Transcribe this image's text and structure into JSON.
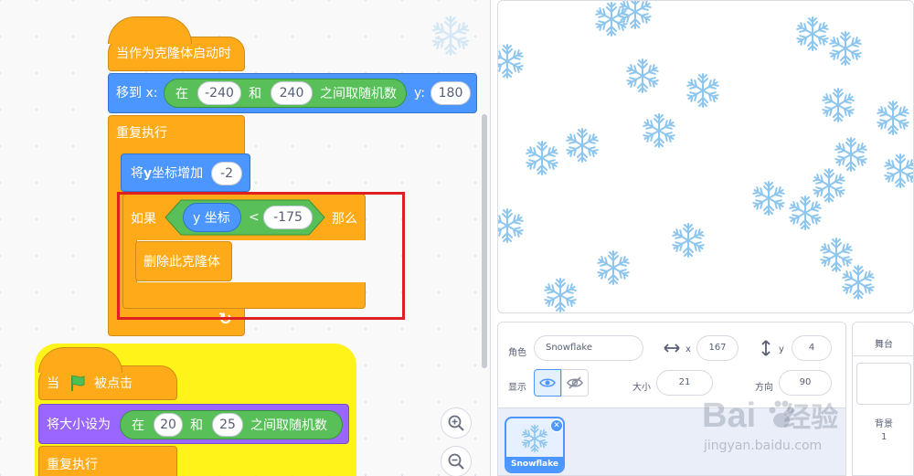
{
  "code": {
    "clone_block": {
      "hat_label": "当作为克隆体启动时",
      "goto_label": "移到 x:",
      "random_in": "在",
      "random_from": "-240",
      "random_and": "和",
      "random_to": "240",
      "random_label": "之间取随机数",
      "y_label": "y:",
      "y_value": "180",
      "forever_label": "重复执行",
      "change_y_label_pre": "将",
      "change_y_label_y": "y",
      "change_y_label_post": "坐标增加",
      "change_y_value": "-2",
      "if_label": "如果",
      "y_reporter": "y 坐标",
      "lt_sign": "<",
      "lt_value": "-175",
      "then_label": "那么",
      "delete_clone_label": "删除此克隆体"
    },
    "flag_block": {
      "hat_when": "当",
      "hat_clicked": "被点击",
      "set_size_label": "将大小设为",
      "random_in": "在",
      "random_from": "20",
      "random_and": "和",
      "random_to": "25",
      "random_label": "之间取随机数",
      "forever_label": "重复执行"
    },
    "zoom_in_icon": "zoom-in-icon",
    "zoom_out_icon": "zoom-out-icon"
  },
  "sprite_info": {
    "sprite_label": "角色",
    "sprite_name": "Snowflake",
    "x_label": "x",
    "x_value": "167",
    "y_label": "y",
    "y_value": "4",
    "show_label": "显示",
    "size_label": "大小",
    "size_value": "21",
    "direction_label": "方向",
    "direction_value": "90"
  },
  "sprite_list": [
    {
      "name": "Snowflake",
      "selected": true
    }
  ],
  "stage_pane": {
    "title": "舞台",
    "backdrop_label": "背景",
    "backdrop_count": "1"
  },
  "watermark": {
    "brand": "Bai",
    "brand_tail": "经验",
    "url": "jingyan.baidu.com"
  },
  "colors": {
    "events": "#ffab19",
    "motion": "#4c97ff",
    "looks": "#9966ff",
    "operators": "#59c059",
    "sensing": "#5cb1d6",
    "highlight": "#e02020",
    "snowflake": "#8fc6ee"
  }
}
